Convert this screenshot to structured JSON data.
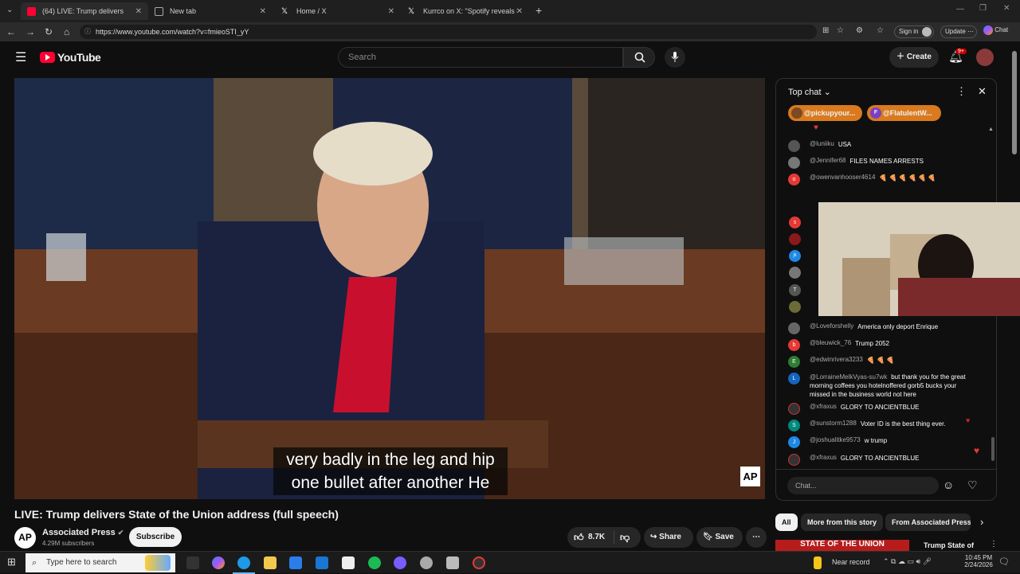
{
  "browser": {
    "tabs": [
      {
        "label": "(64) LIVE: Trump delivers State",
        "active": true
      },
      {
        "label": "New tab",
        "active": false
      },
      {
        "label": "Home / X",
        "active": false
      },
      {
        "label": "Kurrco on X: \"Spotify reveals its la",
        "active": false
      }
    ],
    "url": "https://www.youtube.com/watch?v=fmieoSTI_yY",
    "sign_in_label": "Sign in",
    "update_label": "Update",
    "chat_label": "Chat"
  },
  "youtube": {
    "logo": "YouTube",
    "search_placeholder": "Search",
    "create_label": "Create",
    "notif_badge": "9+"
  },
  "video": {
    "caption_line1": "very badly in the leg and hip",
    "caption_line2": "one bullet after another He",
    "watermark": "AP",
    "title": "LIVE: Trump delivers State of the Union address (full speech)",
    "channel": "Associated Press",
    "subscribers": "4.29M subscribers",
    "subscribe_label": "Subscribe",
    "likes": "8.7K",
    "share_label": "Share",
    "save_label": "Save"
  },
  "chat": {
    "header": "Top chat",
    "pinned": [
      {
        "label": "@pickupyour...",
        "color": "#d97a1e"
      },
      {
        "label": "@FlatulentW...",
        "color": "#d97a1e"
      }
    ],
    "messages": [
      {
        "author": "@luniiku",
        "text": "USA",
        "avatar": "",
        "color": "#555"
      },
      {
        "author": "@Jennifer68",
        "text": "FILES NAMES ARRESTS",
        "avatar": "",
        "color": "#777"
      },
      {
        "author": "@owenvanhooser4614",
        "text": "🍕 🍕 🍕 🍕 🍕 🍕",
        "avatar": "o",
        "color": "#e53935"
      },
      {
        "author": "@Loveforshelly",
        "text": "America only deport Enrique",
        "avatar": "",
        "color": "#666"
      },
      {
        "author": "@bleuwick_76",
        "text": "Trump 2052",
        "avatar": "b",
        "color": "#e53935"
      },
      {
        "author": "@edwinrivera3233",
        "text": "🍕 🍕 🍕",
        "avatar": "E",
        "color": "#2e7d32"
      },
      {
        "author": "@LorraineMelkVyas-su7wk",
        "text": "but thank you for the great morning coffees you hotelnoffered gorb5 bucks your missed in the business world not here",
        "avatar": "L",
        "color": "#1565c0"
      },
      {
        "author": "@xfraxus",
        "text": "GLORY TO ANCIENTBLUE",
        "avatar": "",
        "color": "#333"
      },
      {
        "author": "@sunstorm1288",
        "text": "Voter ID is the best thing ever.",
        "avatar": "S",
        "color": "#00897b"
      },
      {
        "author": "@joshualitke9573",
        "text": "w trump",
        "avatar": "J",
        "color": "#1e88e5"
      },
      {
        "author": "@xfraxus",
        "text": "GLORY TO ANCIENTBLUE",
        "avatar": "",
        "color": "#333"
      }
    ],
    "hidden_avatars": [
      "s",
      "",
      "jk",
      "",
      "T",
      ""
    ],
    "input_placeholder": "Chat..."
  },
  "chips": {
    "all": "All",
    "more": "More from this story",
    "from": "From Associated Press"
  },
  "recommendation": {
    "title": "Trump State of",
    "thumb_text": "STATE OF THE UNION"
  },
  "taskbar": {
    "search_placeholder": "Type here to search",
    "near_record": "Near record",
    "time": "10:45 PM",
    "date": "2/24/2026"
  }
}
